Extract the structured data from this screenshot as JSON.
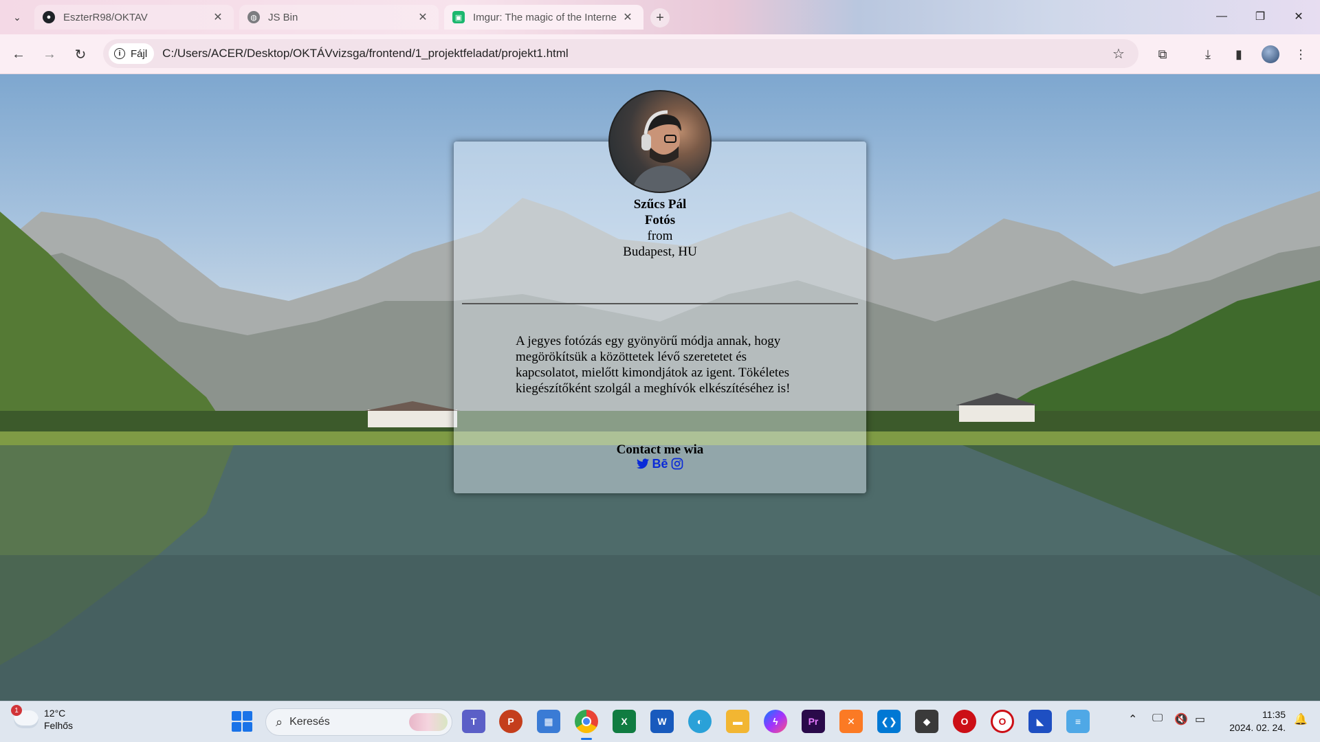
{
  "browser": {
    "tabs": [
      {
        "label": "EszterR98/OKTAV",
        "icon": "github-icon"
      },
      {
        "label": "JS Bin",
        "icon": "globe-icon"
      },
      {
        "label": "Imgur: The magic of the Interne",
        "icon": "imgur-icon",
        "active": true
      }
    ],
    "address": {
      "chip_label": "Fájl",
      "url": "C:/Users/ACER/Desktop/OKTÁVvizsga/frontend/1_projektfeladat/projekt1.html"
    }
  },
  "profile_card": {
    "name": "Szűcs Pál",
    "role": "Fotós",
    "from_label": "from",
    "location": "Budapest, HU",
    "bio": "A jegyes fotózás egy gyönyörű módja annak, hogy megörökítsük a közöttetek lévő szeretetet és kapcsolatot, mielőtt kimondjátok az igent. Tökéletes kiegészítőként szolgál a meghívók elkészítéséhez is!",
    "contact_label": "Contact me wia",
    "socials": [
      {
        "icon": "twitter-icon"
      },
      {
        "icon": "behance-icon",
        "text": "Bē"
      },
      {
        "icon": "instagram-icon"
      }
    ],
    "link_color": "#0a2ad8"
  },
  "taskbar": {
    "weather": {
      "temp": "12°C",
      "condition": "Felhős",
      "badge": "1"
    },
    "search_placeholder": "Keresés",
    "clock": {
      "time": "11:35",
      "date": "2024. 02. 24."
    }
  }
}
